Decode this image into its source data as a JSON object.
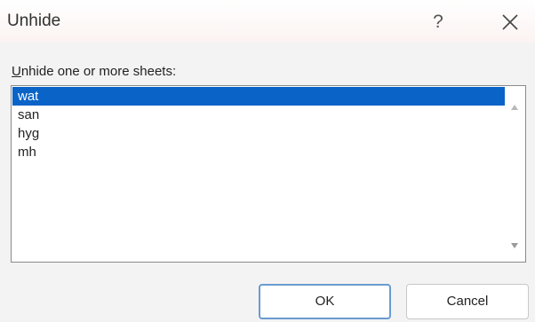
{
  "window": {
    "title": "Unhide",
    "help_label": "?"
  },
  "prompt": {
    "mnemonic": "U",
    "rest": "nhide one or more sheets:"
  },
  "sheets": [
    {
      "label": "wat",
      "selected": true
    },
    {
      "label": "san",
      "selected": false
    },
    {
      "label": "hyg",
      "selected": false
    },
    {
      "label": "mh",
      "selected": false
    }
  ],
  "buttons": {
    "ok": "OK",
    "cancel": "Cancel"
  },
  "icons": {
    "close": "close-icon",
    "scroll_up": "scroll-up-arrow-icon",
    "scroll_down": "scroll-down-arrow-icon"
  },
  "colors": {
    "selection": "#0a64c8",
    "ok_border": "#6a9bd0"
  }
}
